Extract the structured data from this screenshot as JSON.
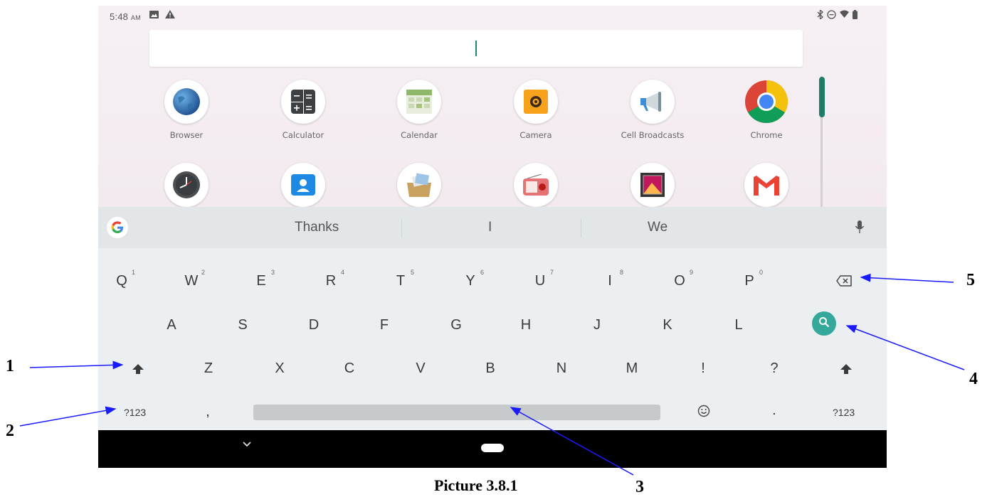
{
  "status_bar": {
    "time": "5:48",
    "am": "AM"
  },
  "apps_row1": [
    {
      "label": "Browser",
      "icon": "browser-globe-icon"
    },
    {
      "label": "Calculator",
      "icon": "calculator-icon"
    },
    {
      "label": "Calendar",
      "icon": "calendar-icon"
    },
    {
      "label": "Camera",
      "icon": "camera-icon"
    },
    {
      "label": "Cell Broadcasts",
      "icon": "megaphone-icon"
    },
    {
      "label": "Chrome",
      "icon": "chrome-icon"
    }
  ],
  "apps_row2_icons": [
    "clock-icon",
    "contacts-icon",
    "file-manager-icon",
    "fm-radio-icon",
    "gallery-icon",
    "gmail-icon"
  ],
  "keyboard": {
    "suggestions": [
      "Thanks",
      "I",
      "We"
    ],
    "row1": [
      {
        "key": "Q",
        "hint": "1"
      },
      {
        "key": "W",
        "hint": "2"
      },
      {
        "key": "E",
        "hint": "3"
      },
      {
        "key": "R",
        "hint": "4"
      },
      {
        "key": "T",
        "hint": "5"
      },
      {
        "key": "Y",
        "hint": "6"
      },
      {
        "key": "U",
        "hint": "7"
      },
      {
        "key": "I",
        "hint": "8"
      },
      {
        "key": "O",
        "hint": "9"
      },
      {
        "key": "P",
        "hint": "0"
      }
    ],
    "row2": [
      "A",
      "S",
      "D",
      "F",
      "G",
      "H",
      "J",
      "K",
      "L"
    ],
    "row3": [
      "Z",
      "X",
      "C",
      "V",
      "B",
      "N",
      "M",
      "!",
      "?"
    ],
    "row4": {
      "symbols_left": "?123",
      "comma": ",",
      "period": ".",
      "symbols_right": "?123"
    }
  },
  "annotations": {
    "callouts": [
      "1",
      "2",
      "3",
      "4",
      "5"
    ],
    "caption": "Picture 3.8.1"
  },
  "colors": {
    "accent": "#34a89a",
    "arrow": "#1a1aff",
    "navbar": "#000000"
  }
}
